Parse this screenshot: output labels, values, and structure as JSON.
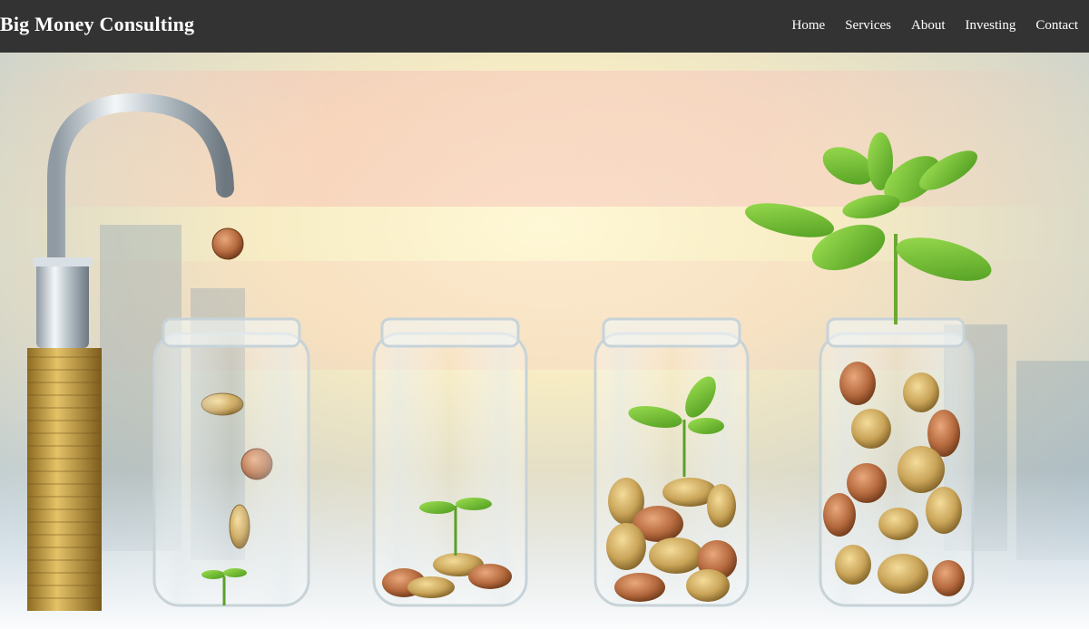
{
  "site": {
    "brand": "Big Money Consulting"
  },
  "nav": {
    "items": [
      {
        "label": "Home"
      },
      {
        "label": "Services"
      },
      {
        "label": "About"
      },
      {
        "label": "Investing"
      },
      {
        "label": "Contact"
      }
    ]
  },
  "hero": {
    "image": "money-growth-jars-illustration",
    "colors": {
      "navbar": "#333333",
      "sky_warm": "#fbe9b4",
      "sky_cool": "#a9c7dd",
      "leaf": "#7cc23a",
      "coin_gold": "#c9a458",
      "coin_copper": "#b56a3e"
    }
  }
}
